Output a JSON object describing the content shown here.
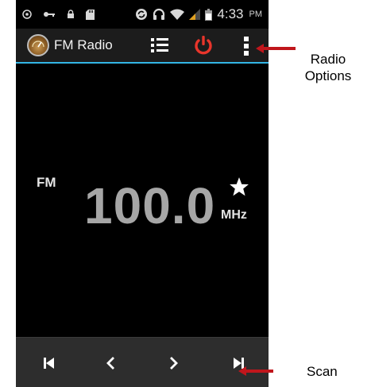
{
  "status_bar": {
    "time": "4:33",
    "ampm": "PM",
    "icons": [
      "sim-icon",
      "key-icon",
      "lock-icon",
      "sdcard-icon",
      "sync-icon",
      "headphones-icon",
      "wifi-icon",
      "signal-icon",
      "battery-icon"
    ]
  },
  "action_bar": {
    "title": "FM Radio",
    "icons": [
      "fm-radio-app-icon",
      "station-list-icon",
      "power-icon",
      "overflow-menu-icon"
    ]
  },
  "tuner": {
    "band": "FM",
    "frequency": "100.0",
    "unit": "MHz",
    "favorite_icon": "star-icon"
  },
  "controls": {
    "icons": [
      "previous-station-icon",
      "seek-down-icon",
      "seek-up-icon",
      "next-station-icon"
    ]
  },
  "annotations": {
    "radio_options_line1": "Radio",
    "radio_options_line2": "Options",
    "scan": "Scan"
  },
  "colors": {
    "accent": "#33b5e5",
    "power": "#e8352b",
    "annotation_arrow": "#c0161c"
  }
}
